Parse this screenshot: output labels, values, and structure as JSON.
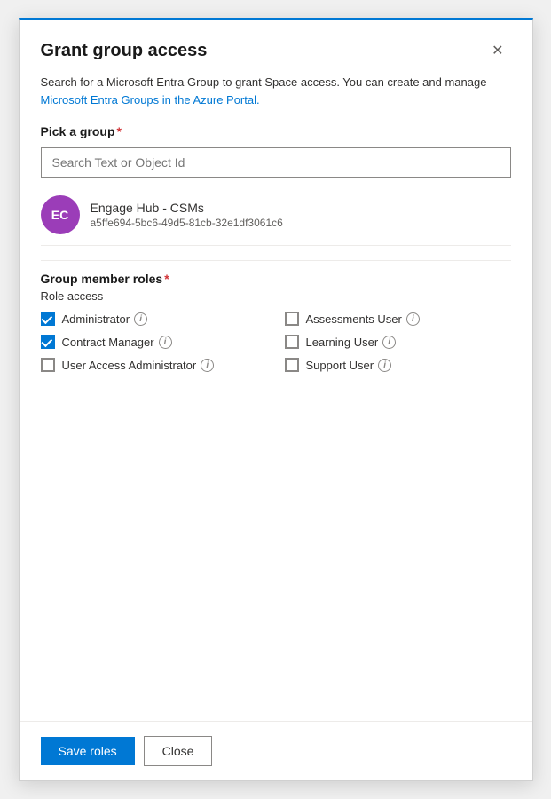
{
  "modal": {
    "title": "Grant group access",
    "close_label": "✕"
  },
  "description": {
    "text": "Search for a Microsoft Entra Group to grant Space access. You can create and manage",
    "link_text": "Microsoft Entra Groups in the Azure Portal."
  },
  "pick_group": {
    "label": "Pick a group",
    "required": "*",
    "search_placeholder": "Search Text or Object Id"
  },
  "selected_group": {
    "initials": "EC",
    "name": "Engage Hub - CSMs",
    "id": "a5ffe694-5bc6-49d5-81cb-32e1df3061c6"
  },
  "group_member_roles": {
    "label": "Group member roles",
    "required": "*",
    "role_access_label": "Role access",
    "roles": [
      {
        "id": "administrator",
        "label": "Administrator",
        "checked": true,
        "col": 1
      },
      {
        "id": "assessments-user",
        "label": "Assessments User",
        "checked": false,
        "col": 2
      },
      {
        "id": "contract-manager",
        "label": "Contract Manager",
        "checked": true,
        "col": 1
      },
      {
        "id": "learning-user",
        "label": "Learning User",
        "checked": false,
        "col": 2
      },
      {
        "id": "user-access-administrator",
        "label": "User Access Administrator",
        "checked": false,
        "col": 1
      },
      {
        "id": "support-user",
        "label": "Support User",
        "checked": false,
        "col": 2
      }
    ]
  },
  "footer": {
    "save_label": "Save roles",
    "close_label": "Close"
  }
}
